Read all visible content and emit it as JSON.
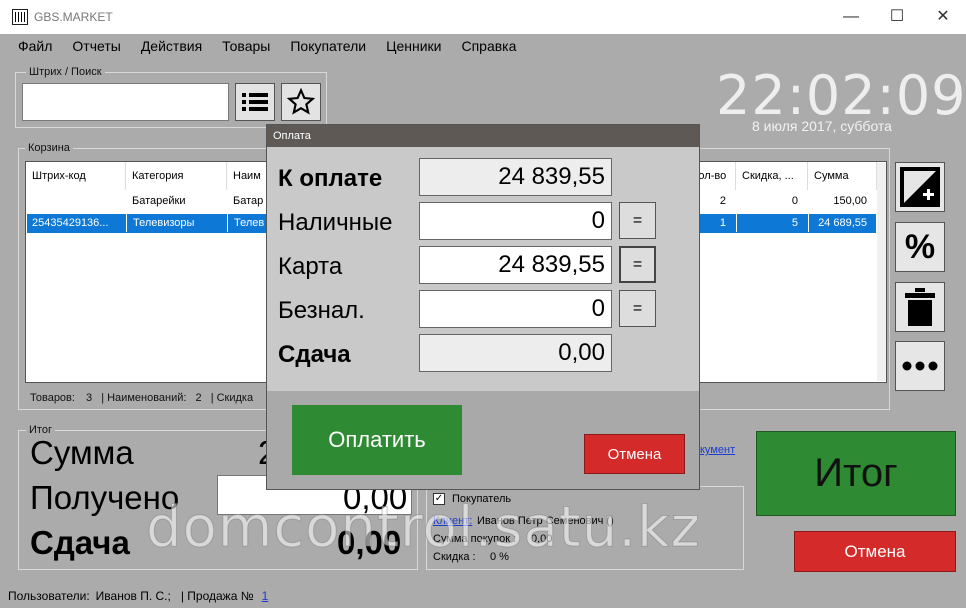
{
  "window": {
    "title": "GBS.MARKET",
    "minimize": "—",
    "maximize": "☐",
    "close": "✕"
  },
  "menu": [
    "Файл",
    "Отчеты",
    "Действия",
    "Товары",
    "Покупатели",
    "Ценники",
    "Справка"
  ],
  "search": {
    "group_label": "Штрих / Поиск",
    "value": ""
  },
  "clock": {
    "time": "22:02:09",
    "date": "8 июля 2017, суббота"
  },
  "cart": {
    "group_label": "Корзина",
    "columns": [
      "Штрих-код",
      "Категория",
      "Наим",
      "Кол-во",
      "Скидка, ...",
      "Сумма"
    ],
    "rows": [
      {
        "barcode": "",
        "category": "Батарейки",
        "name": "Батар",
        "qty": "2",
        "discount": "0",
        "sum": "150,00"
      },
      {
        "barcode": "25435429136...",
        "category": "Телевизоры",
        "name": "Телев",
        "qty": "1",
        "discount": "5",
        "sum": "24 689,55"
      }
    ],
    "status": {
      "goods_label": "Товаров:",
      "goods": "3",
      "names_label": "| Наименований:",
      "names": "2",
      "discount_label": "| Скидка"
    }
  },
  "totals": {
    "group_label": "Итог",
    "sum_label": "Сумма",
    "sum_value": "2",
    "received_label": "Получено",
    "received_value": "0,00",
    "change_label": "Сдача",
    "change_value": "0,00"
  },
  "customer": {
    "doc_link": "кумент",
    "checkbox_label": "Покупатель",
    "checked": true,
    "client_label": "Клиент:",
    "client_name": "Иванов Петр Семенович ()",
    "purchases_label": "Сумма покупок :",
    "purchases_value": "0,00",
    "discount_label": "Скидка :",
    "discount_value": "0 %"
  },
  "buttons": {
    "itog": "Итог",
    "cancel": "Отмена"
  },
  "statusbar": {
    "users_label": "Пользователи:",
    "user": "Иванов П. С.;",
    "sale_label": "| Продажа №",
    "sale_no": "1"
  },
  "dialog": {
    "title": "Оплата",
    "to_pay_label": "К оплате",
    "to_pay": "24 839,55",
    "cash_label": "Наличные",
    "cash": "0",
    "card_label": "Карта",
    "card": "24 839,55",
    "noncash_label": "Безнал.",
    "noncash": "0",
    "change_label": "Сдача",
    "change": "0,00",
    "eq": "=",
    "pay_button": "Оплатить",
    "cancel_button": "Отмена"
  },
  "watermark": "domcontrol.satu.kz",
  "colors": {
    "accent_green": "#2f8b33",
    "cancel_red": "#d42a2a",
    "selection_blue": "#0e78d6"
  }
}
